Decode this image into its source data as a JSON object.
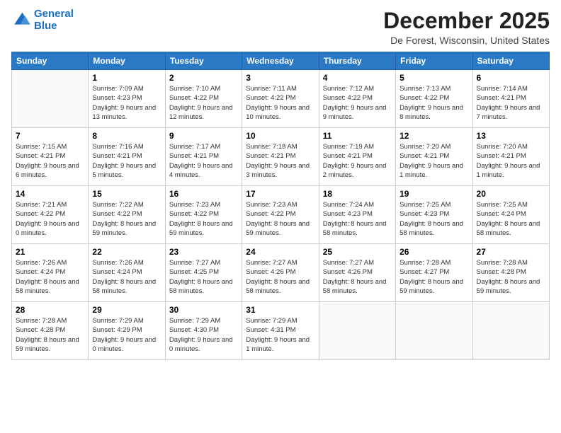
{
  "logo": {
    "line1": "General",
    "line2": "Blue"
  },
  "title": "December 2025",
  "location": "De Forest, Wisconsin, United States",
  "header_days": [
    "Sunday",
    "Monday",
    "Tuesday",
    "Wednesday",
    "Thursday",
    "Friday",
    "Saturday"
  ],
  "weeks": [
    [
      {
        "day": "",
        "sunrise": "",
        "sunset": "",
        "daylight": ""
      },
      {
        "day": "1",
        "sunrise": "Sunrise: 7:09 AM",
        "sunset": "Sunset: 4:23 PM",
        "daylight": "Daylight: 9 hours and 13 minutes."
      },
      {
        "day": "2",
        "sunrise": "Sunrise: 7:10 AM",
        "sunset": "Sunset: 4:22 PM",
        "daylight": "Daylight: 9 hours and 12 minutes."
      },
      {
        "day": "3",
        "sunrise": "Sunrise: 7:11 AM",
        "sunset": "Sunset: 4:22 PM",
        "daylight": "Daylight: 9 hours and 10 minutes."
      },
      {
        "day": "4",
        "sunrise": "Sunrise: 7:12 AM",
        "sunset": "Sunset: 4:22 PM",
        "daylight": "Daylight: 9 hours and 9 minutes."
      },
      {
        "day": "5",
        "sunrise": "Sunrise: 7:13 AM",
        "sunset": "Sunset: 4:22 PM",
        "daylight": "Daylight: 9 hours and 8 minutes."
      },
      {
        "day": "6",
        "sunrise": "Sunrise: 7:14 AM",
        "sunset": "Sunset: 4:21 PM",
        "daylight": "Daylight: 9 hours and 7 minutes."
      }
    ],
    [
      {
        "day": "7",
        "sunrise": "Sunrise: 7:15 AM",
        "sunset": "Sunset: 4:21 PM",
        "daylight": "Daylight: 9 hours and 6 minutes."
      },
      {
        "day": "8",
        "sunrise": "Sunrise: 7:16 AM",
        "sunset": "Sunset: 4:21 PM",
        "daylight": "Daylight: 9 hours and 5 minutes."
      },
      {
        "day": "9",
        "sunrise": "Sunrise: 7:17 AM",
        "sunset": "Sunset: 4:21 PM",
        "daylight": "Daylight: 9 hours and 4 minutes."
      },
      {
        "day": "10",
        "sunrise": "Sunrise: 7:18 AM",
        "sunset": "Sunset: 4:21 PM",
        "daylight": "Daylight: 9 hours and 3 minutes."
      },
      {
        "day": "11",
        "sunrise": "Sunrise: 7:19 AM",
        "sunset": "Sunset: 4:21 PM",
        "daylight": "Daylight: 9 hours and 2 minutes."
      },
      {
        "day": "12",
        "sunrise": "Sunrise: 7:20 AM",
        "sunset": "Sunset: 4:21 PM",
        "daylight": "Daylight: 9 hours and 1 minute."
      },
      {
        "day": "13",
        "sunrise": "Sunrise: 7:20 AM",
        "sunset": "Sunset: 4:21 PM",
        "daylight": "Daylight: 9 hours and 1 minute."
      }
    ],
    [
      {
        "day": "14",
        "sunrise": "Sunrise: 7:21 AM",
        "sunset": "Sunset: 4:22 PM",
        "daylight": "Daylight: 9 hours and 0 minutes."
      },
      {
        "day": "15",
        "sunrise": "Sunrise: 7:22 AM",
        "sunset": "Sunset: 4:22 PM",
        "daylight": "Daylight: 8 hours and 59 minutes."
      },
      {
        "day": "16",
        "sunrise": "Sunrise: 7:23 AM",
        "sunset": "Sunset: 4:22 PM",
        "daylight": "Daylight: 8 hours and 59 minutes."
      },
      {
        "day": "17",
        "sunrise": "Sunrise: 7:23 AM",
        "sunset": "Sunset: 4:22 PM",
        "daylight": "Daylight: 8 hours and 59 minutes."
      },
      {
        "day": "18",
        "sunrise": "Sunrise: 7:24 AM",
        "sunset": "Sunset: 4:23 PM",
        "daylight": "Daylight: 8 hours and 58 minutes."
      },
      {
        "day": "19",
        "sunrise": "Sunrise: 7:25 AM",
        "sunset": "Sunset: 4:23 PM",
        "daylight": "Daylight: 8 hours and 58 minutes."
      },
      {
        "day": "20",
        "sunrise": "Sunrise: 7:25 AM",
        "sunset": "Sunset: 4:24 PM",
        "daylight": "Daylight: 8 hours and 58 minutes."
      }
    ],
    [
      {
        "day": "21",
        "sunrise": "Sunrise: 7:26 AM",
        "sunset": "Sunset: 4:24 PM",
        "daylight": "Daylight: 8 hours and 58 minutes."
      },
      {
        "day": "22",
        "sunrise": "Sunrise: 7:26 AM",
        "sunset": "Sunset: 4:24 PM",
        "daylight": "Daylight: 8 hours and 58 minutes."
      },
      {
        "day": "23",
        "sunrise": "Sunrise: 7:27 AM",
        "sunset": "Sunset: 4:25 PM",
        "daylight": "Daylight: 8 hours and 58 minutes."
      },
      {
        "day": "24",
        "sunrise": "Sunrise: 7:27 AM",
        "sunset": "Sunset: 4:26 PM",
        "daylight": "Daylight: 8 hours and 58 minutes."
      },
      {
        "day": "25",
        "sunrise": "Sunrise: 7:27 AM",
        "sunset": "Sunset: 4:26 PM",
        "daylight": "Daylight: 8 hours and 58 minutes."
      },
      {
        "day": "26",
        "sunrise": "Sunrise: 7:28 AM",
        "sunset": "Sunset: 4:27 PM",
        "daylight": "Daylight: 8 hours and 59 minutes."
      },
      {
        "day": "27",
        "sunrise": "Sunrise: 7:28 AM",
        "sunset": "Sunset: 4:28 PM",
        "daylight": "Daylight: 8 hours and 59 minutes."
      }
    ],
    [
      {
        "day": "28",
        "sunrise": "Sunrise: 7:28 AM",
        "sunset": "Sunset: 4:28 PM",
        "daylight": "Daylight: 8 hours and 59 minutes."
      },
      {
        "day": "29",
        "sunrise": "Sunrise: 7:29 AM",
        "sunset": "Sunset: 4:29 PM",
        "daylight": "Daylight: 9 hours and 0 minutes."
      },
      {
        "day": "30",
        "sunrise": "Sunrise: 7:29 AM",
        "sunset": "Sunset: 4:30 PM",
        "daylight": "Daylight: 9 hours and 0 minutes."
      },
      {
        "day": "31",
        "sunrise": "Sunrise: 7:29 AM",
        "sunset": "Sunset: 4:31 PM",
        "daylight": "Daylight: 9 hours and 1 minute."
      },
      {
        "day": "",
        "sunrise": "",
        "sunset": "",
        "daylight": ""
      },
      {
        "day": "",
        "sunrise": "",
        "sunset": "",
        "daylight": ""
      },
      {
        "day": "",
        "sunrise": "",
        "sunset": "",
        "daylight": ""
      }
    ]
  ]
}
